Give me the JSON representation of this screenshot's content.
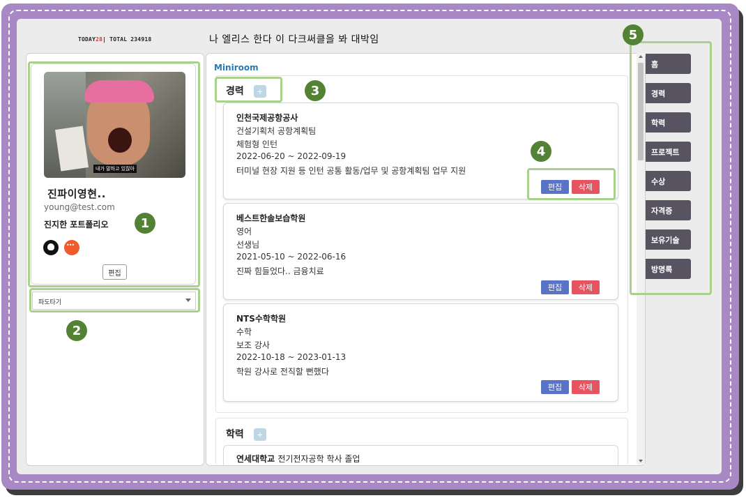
{
  "header": {
    "today_label": "TODAY",
    "today_count": "28",
    "total_label": "| TOTAL 234918",
    "title": "나 엘리스 한다 이 다크써클을 봐 대박임"
  },
  "profile": {
    "photo_caption": "내가 말하고 있잖아",
    "name": "진파이영현..",
    "email": "young@test.com",
    "motto": "진지한 포트폴리오",
    "edit_label": "편집",
    "icons": [
      "github-icon",
      "tistory-icon"
    ]
  },
  "bgm_select": {
    "value": "파도타기"
  },
  "main": {
    "miniroom_label": "Miniroom",
    "career": {
      "heading": "경력",
      "add_label": "+",
      "entries": [
        {
          "org": "인천국제공항공사",
          "dept": "건설기획처 공항계획팀",
          "role": "체험형 인턴",
          "period": "2022-06-20 ~ 2022-09-19",
          "desc": "터미널 현장 지원 등 인턴 공통 활동/업무 및 공항계획팀 업무 지원",
          "edit_label": "편집",
          "delete_label": "삭제"
        },
        {
          "org": "베스트한솔보습학원",
          "dept": "영어",
          "role": "선생님",
          "period": "2021-05-10 ~ 2022-06-16",
          "desc": "진짜 힘들었다.. 금융치료",
          "edit_label": "편집",
          "delete_label": "삭제"
        },
        {
          "org": "NTS수학학원",
          "dept": "수학",
          "role": "보조 강사",
          "period": "2022-10-18 ~ 2023-01-13",
          "desc": "학원 강사로 전직할 뻔했다",
          "edit_label": "편집",
          "delete_label": "삭제"
        }
      ]
    },
    "education": {
      "heading": "학력",
      "add_label": "+",
      "entries": [
        {
          "school": "연세대학교",
          "detail": "전기전자공학 학사 졸업"
        }
      ]
    }
  },
  "nav": {
    "items": [
      "홈",
      "경력",
      "학력",
      "프로젝트",
      "수상",
      "자격증",
      "보유기술",
      "방명록"
    ]
  },
  "annotations": {
    "labels": [
      "1",
      "2",
      "3",
      "4",
      "5"
    ],
    "color": "#548235",
    "highlight_color": "#a9d18e"
  }
}
